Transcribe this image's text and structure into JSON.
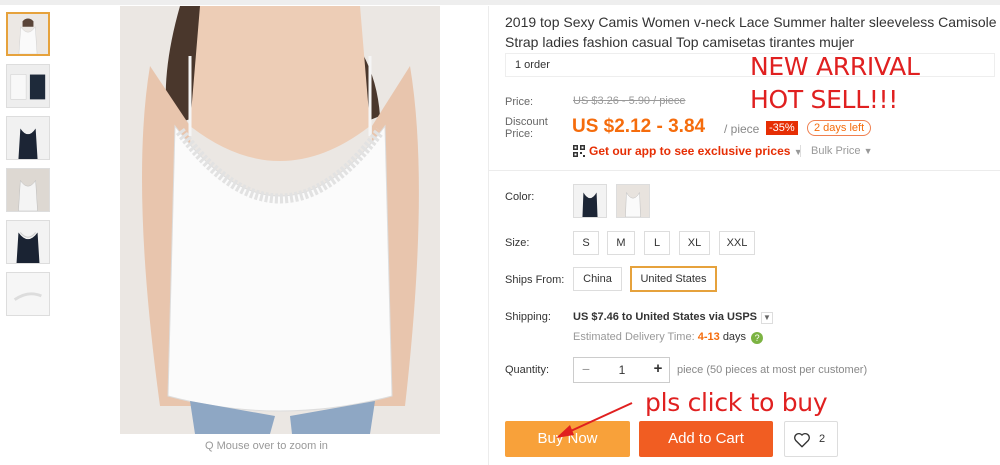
{
  "gallery": {
    "thumbnails": [
      {
        "active": true
      },
      {
        "active": false
      },
      {
        "active": false
      },
      {
        "active": false
      },
      {
        "active": false
      },
      {
        "active": false
      }
    ],
    "zoom_hint": "Q Mouse over to zoom in"
  },
  "product": {
    "title": "2019 top Sexy Camis Women v-neck Lace Summer halter sleeveless Camisole Strap ladies fashion casual Top camisetas tirantes mujer",
    "orders": "1 order"
  },
  "annotations": {
    "new_arrival": "NEW ARRIVAL",
    "hot_sell": "HOT SELL!!!",
    "click_to_buy": "pls click to buy"
  },
  "price": {
    "label": "Price:",
    "original": "US $3.26 - 5.90 / piece",
    "discount_label_1": "Discount",
    "discount_label_2": "Price:",
    "discount": "US $2.12 - 3.84",
    "per_piece": "/ piece",
    "percent_off": "-35%",
    "days_left": "2 days left",
    "app_promo": "Get our app to see exclusive prices",
    "bulk_price": "Bulk Price"
  },
  "options": {
    "color_label": "Color:",
    "colors": [
      "black-lace",
      "white-lace"
    ],
    "size_label": "Size:",
    "sizes": [
      "S",
      "M",
      "L",
      "XL",
      "XXL"
    ],
    "ships_from_label": "Ships From:",
    "ships_from": [
      "China",
      "United States"
    ],
    "ships_from_selected": "United States"
  },
  "shipping": {
    "label": "Shipping:",
    "method": "US $7.46 to United States via USPS",
    "estimate_prefix": "Estimated Delivery Time:",
    "estimate_days": "4-13",
    "estimate_unit": "days"
  },
  "quantity": {
    "label": "Quantity:",
    "minus": "−",
    "value": "1",
    "plus": "+",
    "note": "piece (50 pieces at most per customer)"
  },
  "actions": {
    "buy_now": "Buy Now",
    "add_to_cart": "Add to Cart",
    "wishlist_count": "2"
  },
  "colors": {
    "accent_orange": "#f56c0c",
    "buy_now_bg": "#f8a13a",
    "add_to_cart_bg": "#f15d22",
    "annotation_red": "#e02020",
    "selected_border": "#e6a23c"
  }
}
